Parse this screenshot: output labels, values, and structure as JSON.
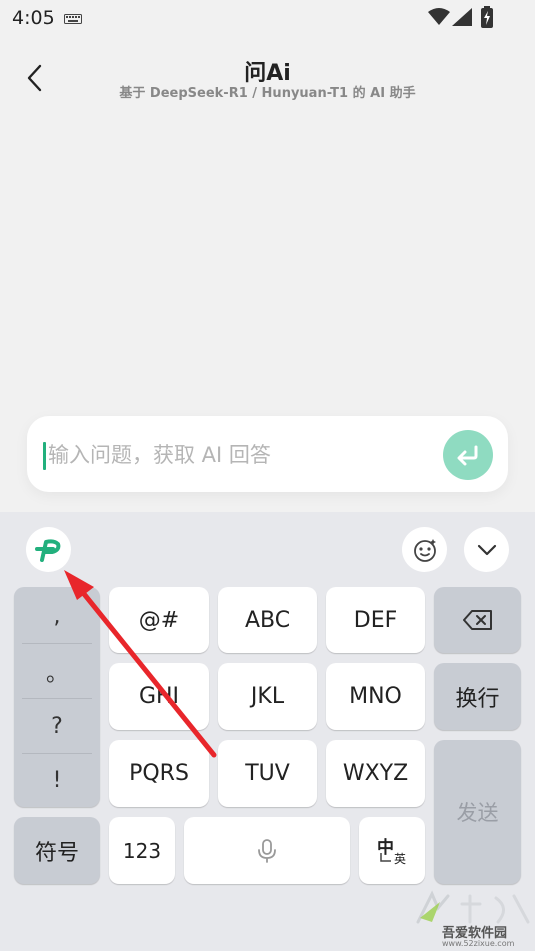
{
  "status_bar": {
    "time": "4:05"
  },
  "header": {
    "title": "问Ai",
    "subtitle": "基于 DeepSeek-R1 / Hunyuan-T1 的 AI 助手"
  },
  "input": {
    "value": "",
    "placeholder": "输入问题，获取 AI 回答"
  },
  "keyboard": {
    "punctuation": [
      ",",
      "。",
      "?",
      "!"
    ],
    "symbols_label": "符号",
    "keys_row1": [
      "@#",
      "ABC",
      "DEF"
    ],
    "keys_row2": [
      "GHI",
      "JKL",
      "MNO"
    ],
    "keys_row3": [
      "PQRS",
      "TUV",
      "WXYZ"
    ],
    "newline_label": "换行",
    "send_label": "发送",
    "numbers_label": "123",
    "lang_zh": "中",
    "lang_en": "英"
  },
  "watermark": {
    "brand": "吾爱软件园",
    "url": "www.52zixue.com"
  },
  "colors": {
    "accent": "#22b07d",
    "send_bg": "#8fdbc1",
    "arrow": "#e8262b"
  }
}
